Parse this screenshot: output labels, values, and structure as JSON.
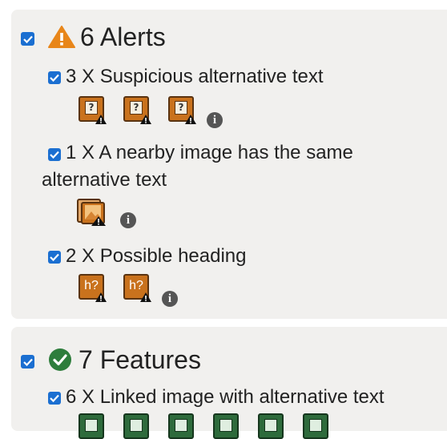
{
  "alerts": {
    "title": "6 Alerts",
    "items": [
      {
        "label": "3 X Suspicious alternative text",
        "icon_count": 3,
        "icon": "suspicious-alt-text-icon",
        "badge": "?"
      },
      {
        "label_line1": "1 X A nearby image has the same",
        "label_line2": "alternative text",
        "icon_count": 1,
        "icon": "duplicate-alt-text-icon"
      },
      {
        "label": "2 X Possible heading",
        "icon_count": 2,
        "icon": "possible-heading-icon",
        "badge": "h?"
      }
    ]
  },
  "features": {
    "title": "7 Features",
    "items": [
      {
        "label": "6 X Linked image with alternative text",
        "icon_count": 6,
        "icon": "linked-image-alt-icon"
      }
    ]
  },
  "colors": {
    "checkbox": "#1b6fd1",
    "alert_icon": "#e8861a",
    "feature_icon": "#2e7d3c",
    "panel_bg": "#f1f0ee",
    "tile_orange": "#c9721d",
    "tile_green": "#2e6b3c"
  }
}
